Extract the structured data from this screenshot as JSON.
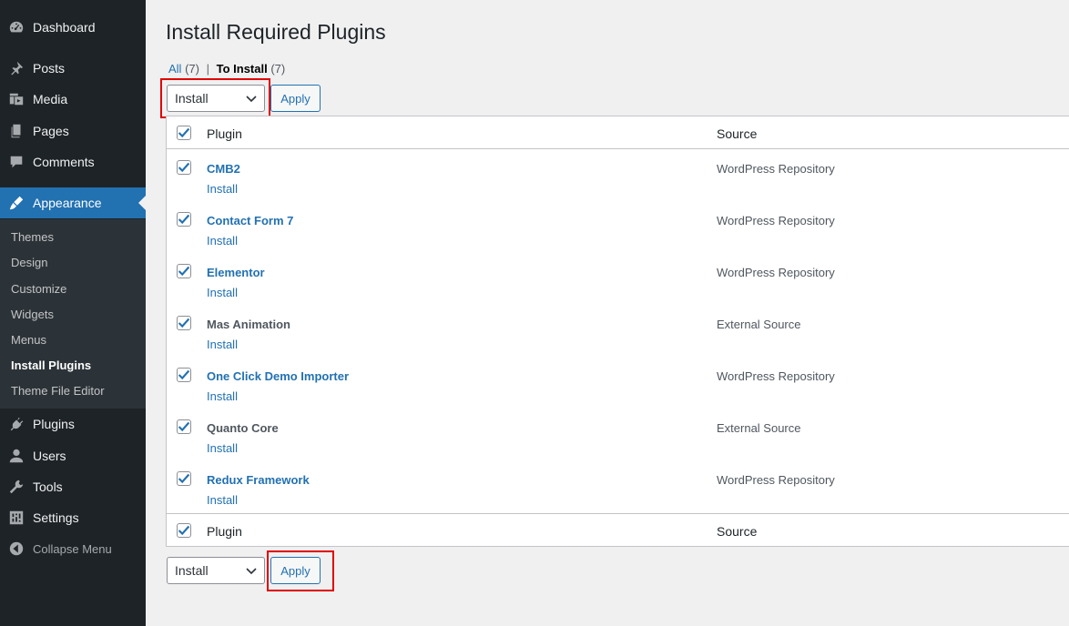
{
  "sidebar": {
    "top_items": [
      {
        "label": "Dashboard",
        "icon": "dashboard-icon"
      },
      {
        "label": "Posts",
        "icon": "pin-icon"
      },
      {
        "label": "Media",
        "icon": "media-icon"
      },
      {
        "label": "Pages",
        "icon": "pages-icon"
      },
      {
        "label": "Comments",
        "icon": "comment-icon"
      },
      {
        "label": "Appearance",
        "icon": "brush-icon"
      }
    ],
    "submenu": [
      "Themes",
      "Design",
      "Customize",
      "Widgets",
      "Menus",
      "Install Plugins",
      "Theme File Editor"
    ],
    "bottom_items": [
      {
        "label": "Plugins",
        "icon": "plug-icon"
      },
      {
        "label": "Users",
        "icon": "user-icon"
      },
      {
        "label": "Tools",
        "icon": "wrench-icon"
      },
      {
        "label": "Settings",
        "icon": "settings-icon"
      }
    ],
    "collapse_label": "Collapse Menu"
  },
  "page": {
    "title": "Install Required Plugins",
    "filters": {
      "all_label": "All",
      "all_count": "(7)",
      "separator": "|",
      "to_install_label": "To Install",
      "to_install_count": "(7)"
    },
    "bulk_action": {
      "selected": "Install",
      "apply_label": "Apply"
    }
  },
  "table": {
    "col_plugin": "Plugin",
    "col_source": "Source",
    "rows": [
      {
        "name": "CMB2",
        "action": "Install",
        "source": "WordPress Repository",
        "linked": true
      },
      {
        "name": "Contact Form 7",
        "action": "Install",
        "source": "WordPress Repository",
        "linked": true
      },
      {
        "name": "Elementor",
        "action": "Install",
        "source": "WordPress Repository",
        "linked": true
      },
      {
        "name": "Mas Animation",
        "action": "Install",
        "source": "External Source",
        "linked": false
      },
      {
        "name": "One Click Demo Importer",
        "action": "Install",
        "source": "WordPress Repository",
        "linked": true
      },
      {
        "name": "Quanto Core",
        "action": "Install",
        "source": "External Source",
        "linked": false
      },
      {
        "name": "Redux Framework",
        "action": "Install",
        "source": "WordPress Repository",
        "linked": true
      }
    ]
  },
  "colors": {
    "accent": "#2271b1",
    "sidebar_bg": "#1d2327",
    "highlight": "#e00000"
  }
}
